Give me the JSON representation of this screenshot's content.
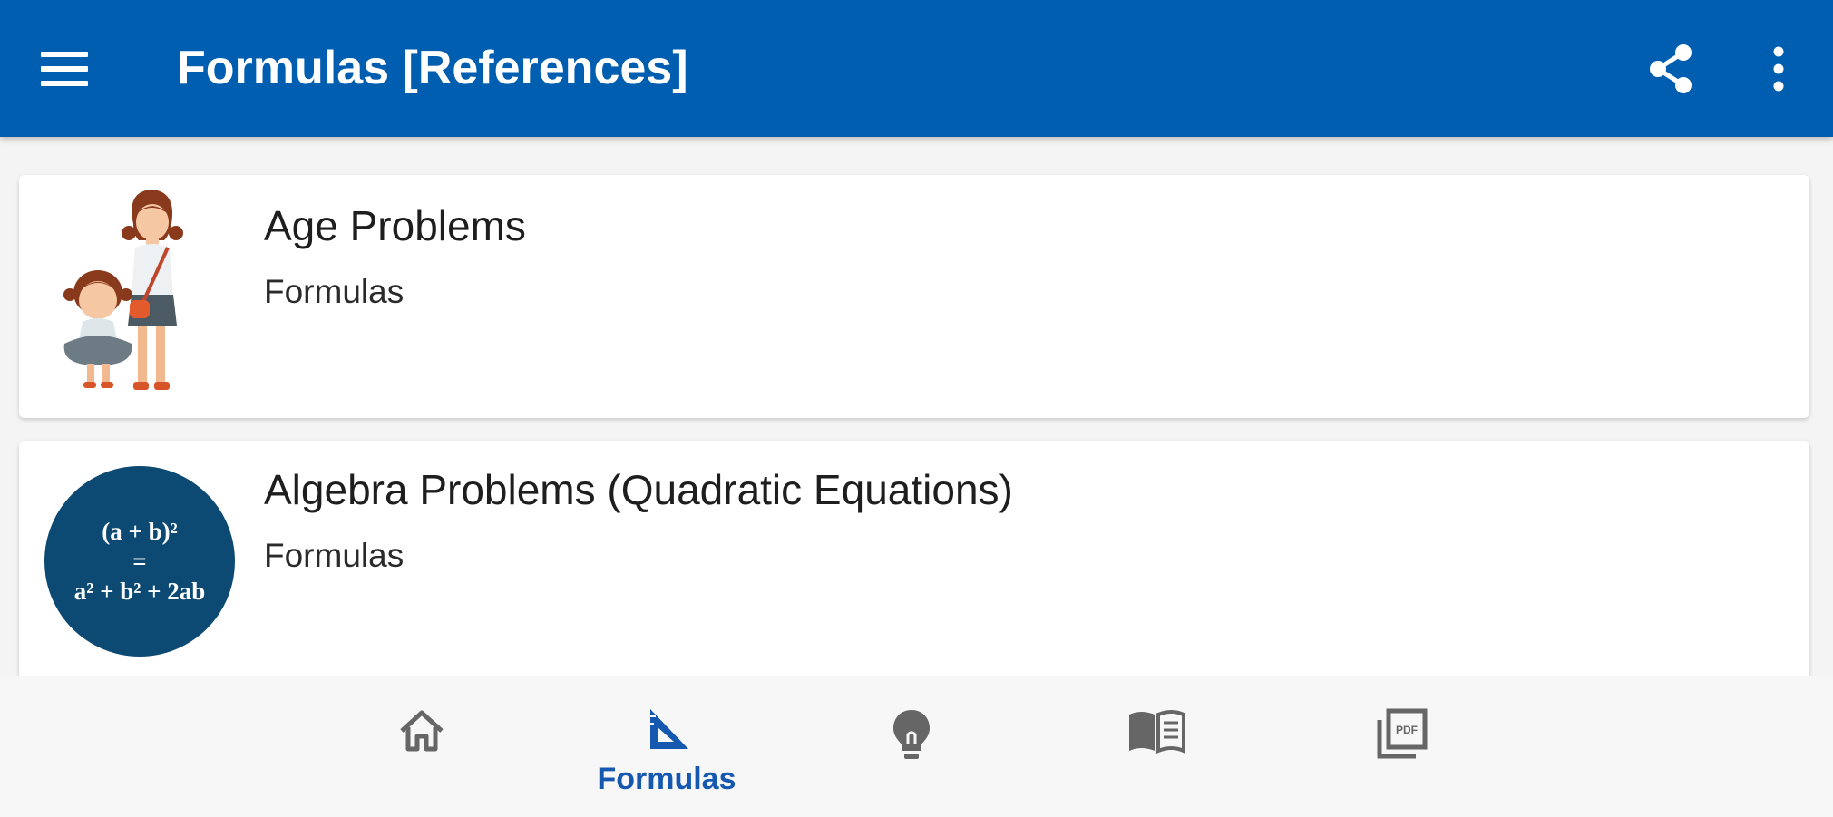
{
  "app": {
    "title": "Formulas [References]",
    "accent_color": "#005eb0",
    "icons": {
      "menu": "hamburger-menu-icon",
      "share": "share-icon",
      "more": "more-vert-icon"
    }
  },
  "items": [
    {
      "title": "Age Problems",
      "subtitle": "Formulas",
      "thumbnail": "mother-and-daughter-illustration"
    },
    {
      "title": "Algebra Problems (Quadratic Equations)",
      "subtitle": "Formulas",
      "thumbnail": "formula-disc",
      "formula": {
        "line1": "(a + b)²",
        "line2": "=",
        "line3": "a² + b² + 2ab"
      }
    }
  ],
  "bottom_nav": {
    "selected": "formulas",
    "items": [
      {
        "id": "home",
        "icon": "home-icon",
        "label": ""
      },
      {
        "id": "formulas",
        "icon": "set-square-icon",
        "label": "Formulas"
      },
      {
        "id": "tips",
        "icon": "lightbulb-icon",
        "label": ""
      },
      {
        "id": "references",
        "icon": "book-icon",
        "label": ""
      },
      {
        "id": "pdf",
        "icon": "pdf-icon",
        "label": ""
      }
    ]
  }
}
